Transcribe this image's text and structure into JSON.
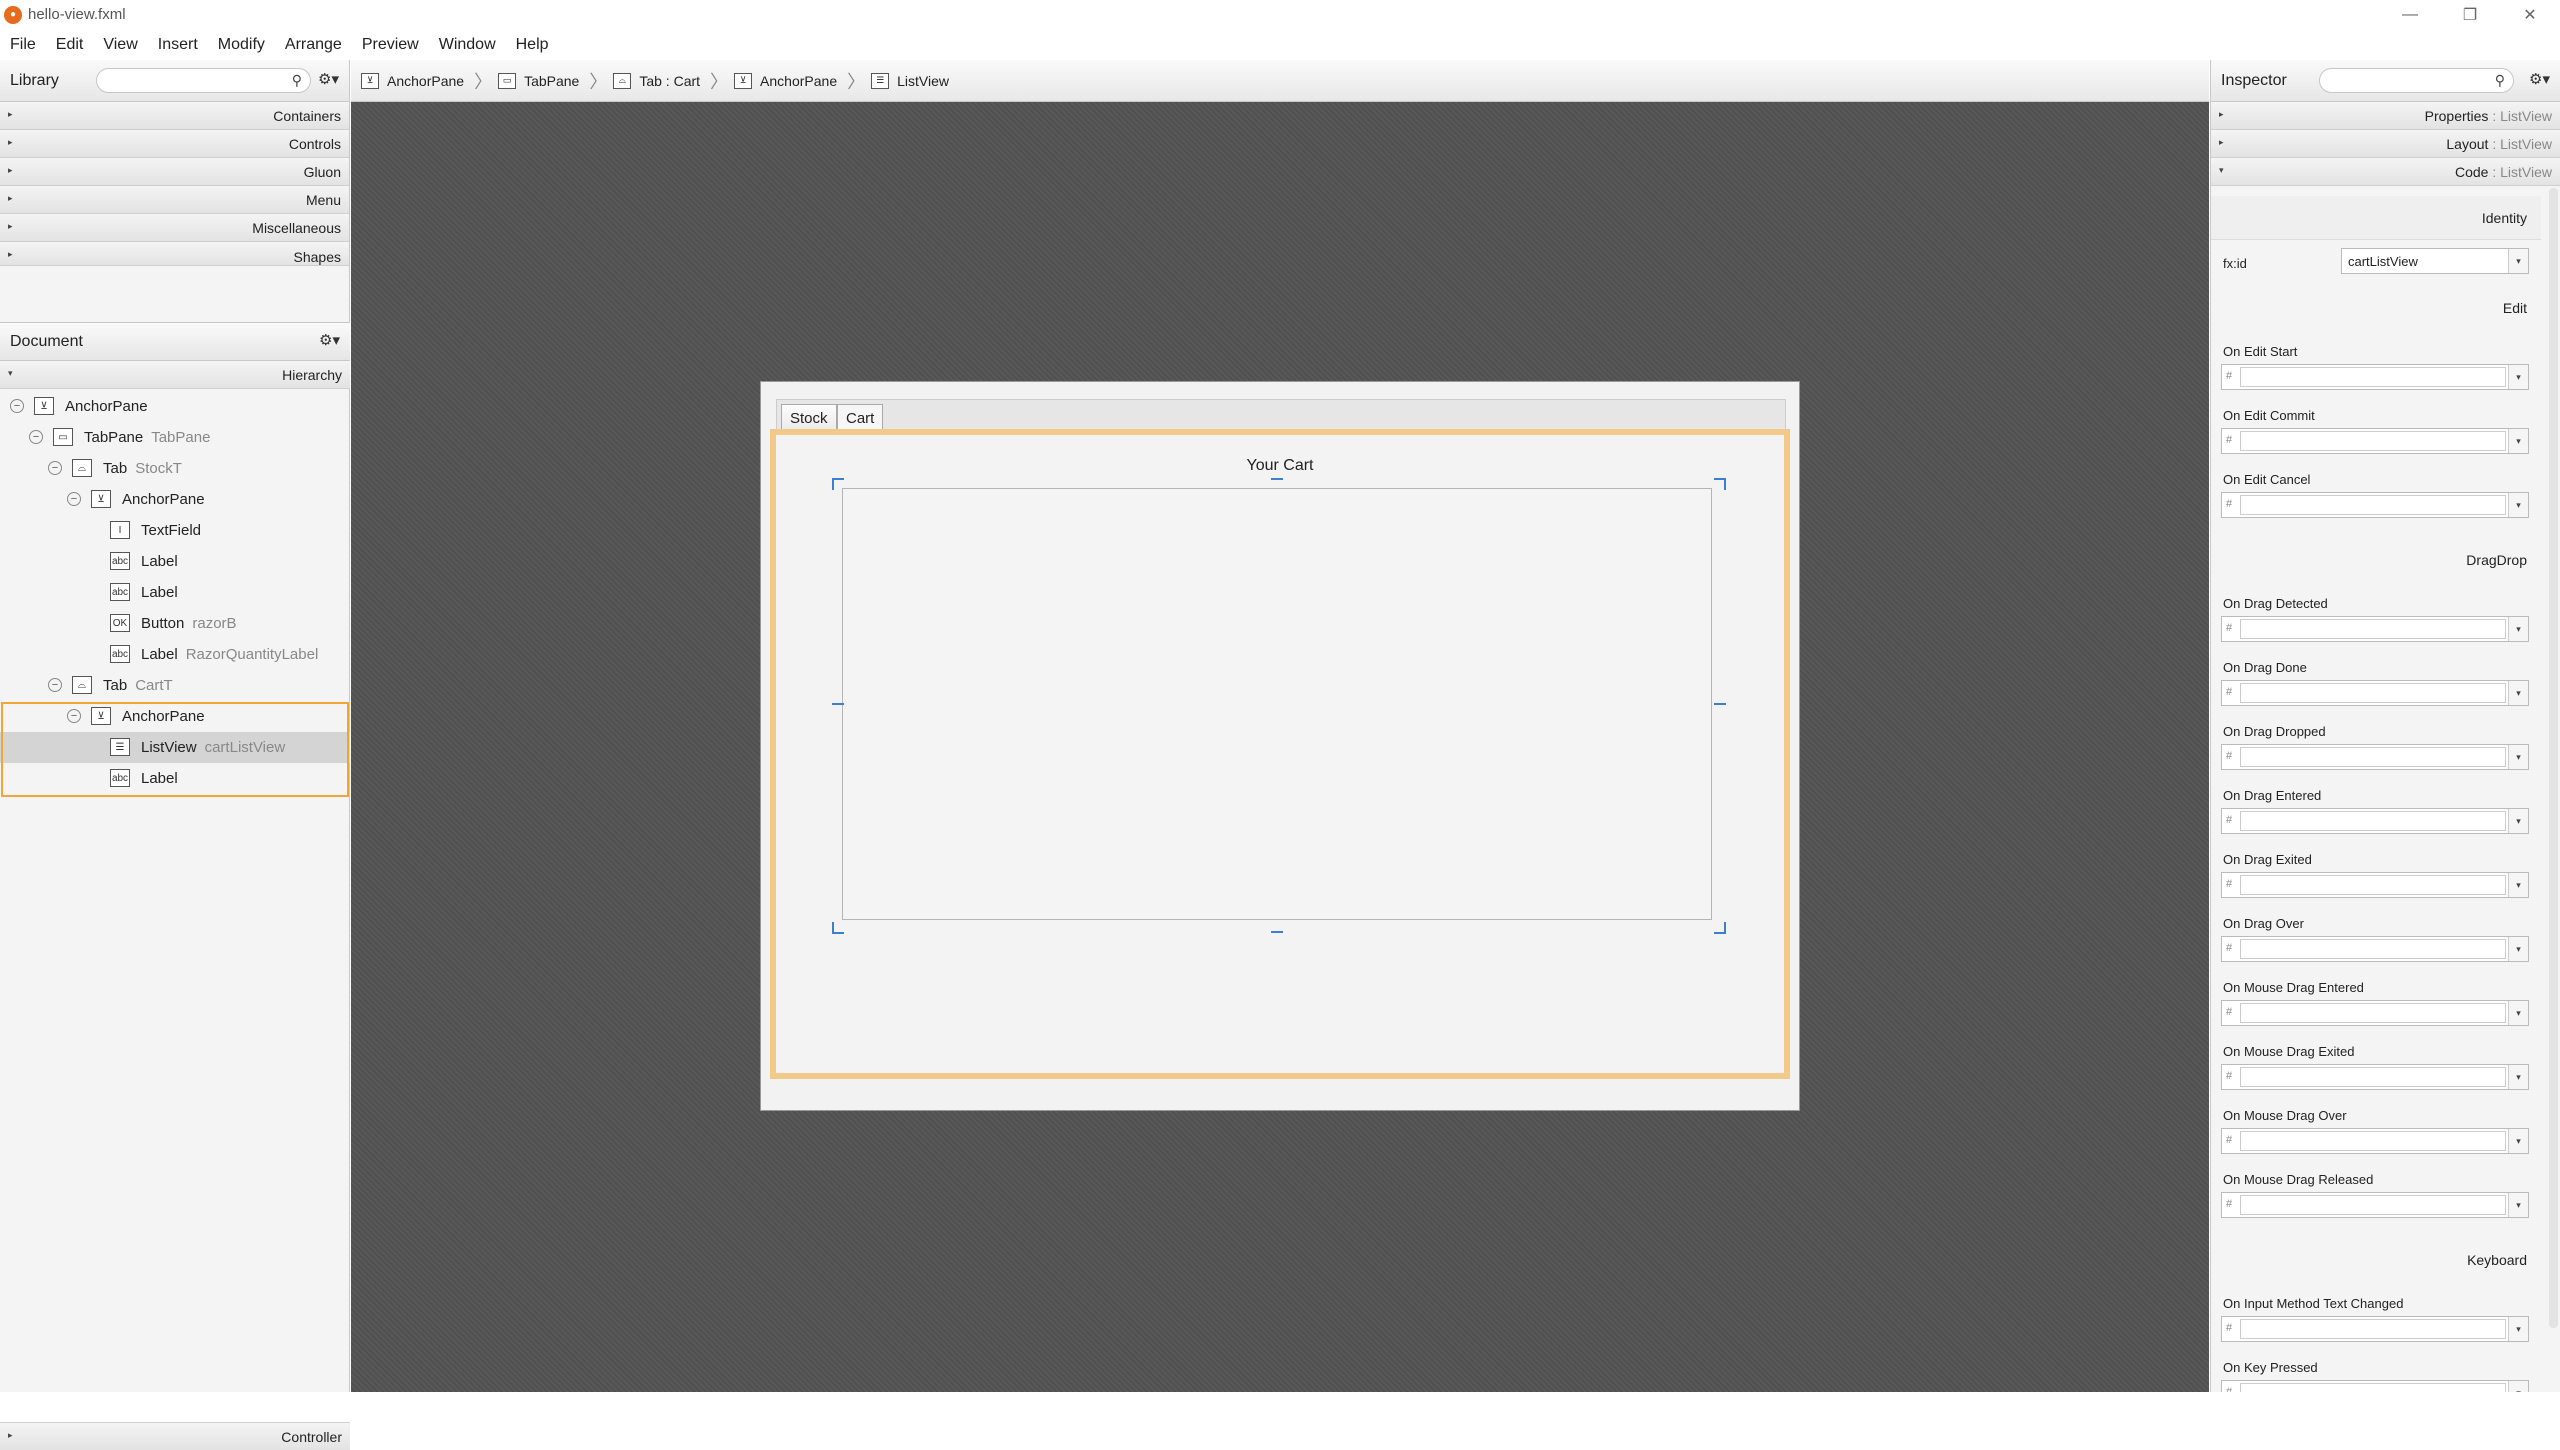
{
  "window": {
    "title": "hello-view.fxml",
    "controls": [
      "—",
      "❐",
      "✕"
    ]
  },
  "menu": [
    "File",
    "Edit",
    "View",
    "Insert",
    "Modify",
    "Arrange",
    "Preview",
    "Window",
    "Help"
  ],
  "library": {
    "title": "Library",
    "sections": [
      "Containers",
      "Controls",
      "Gluon",
      "Menu",
      "Miscellaneous",
      "Shapes"
    ]
  },
  "document": {
    "title": "Document",
    "hierarchy_label": "Hierarchy",
    "controller_label": "Controller",
    "tree": [
      {
        "name": "AnchorPane",
        "id": "",
        "icon": "anchor-pane-icon",
        "glyph": "⊻",
        "depth": 0,
        "toggle": "−"
      },
      {
        "name": "TabPane",
        "id": "TabPane",
        "icon": "tab-pane-icon",
        "glyph": "▭",
        "depth": 1,
        "toggle": "−"
      },
      {
        "name": "Tab",
        "id": "StockT",
        "icon": "tab-icon",
        "glyph": "⌓",
        "depth": 2,
        "toggle": "−"
      },
      {
        "name": "AnchorPane",
        "id": "",
        "icon": "anchor-pane-icon",
        "glyph": "⊻",
        "depth": 3,
        "toggle": "−"
      },
      {
        "name": "TextField",
        "id": "",
        "icon": "text-field-icon",
        "glyph": "I",
        "depth": 4,
        "toggle": ""
      },
      {
        "name": "Label",
        "id": "",
        "icon": "label-icon",
        "glyph": "abc",
        "depth": 4,
        "toggle": ""
      },
      {
        "name": "Label",
        "id": "",
        "icon": "label-icon",
        "glyph": "abc",
        "depth": 4,
        "toggle": ""
      },
      {
        "name": "Button",
        "id": "razorB",
        "icon": "button-icon",
        "glyph": "OK",
        "depth": 4,
        "toggle": ""
      },
      {
        "name": "Label",
        "id": "RazorQuantityLabel",
        "icon": "label-icon",
        "glyph": "abc",
        "depth": 4,
        "toggle": ""
      },
      {
        "name": "Tab",
        "id": "CartT",
        "icon": "tab-icon",
        "glyph": "⌓",
        "depth": 2,
        "toggle": "−"
      },
      {
        "name": "AnchorPane",
        "id": "",
        "icon": "anchor-pane-icon",
        "glyph": "⊻",
        "depth": 3,
        "toggle": "−"
      },
      {
        "name": "ListView",
        "id": "cartListView",
        "icon": "list-view-icon",
        "glyph": "☰",
        "depth": 4,
        "toggle": ""
      },
      {
        "name": "Label",
        "id": "",
        "icon": "label-icon",
        "glyph": "abc",
        "depth": 4,
        "toggle": ""
      }
    ]
  },
  "breadcrumb": [
    {
      "label": "AnchorPane",
      "icon": "anchor-pane-icon",
      "glyph": "⊻"
    },
    {
      "label": "TabPane",
      "icon": "tab-pane-icon",
      "glyph": "▭"
    },
    {
      "label": "Tab : Cart",
      "icon": "tab-icon",
      "glyph": "⌓"
    },
    {
      "label": "AnchorPane",
      "icon": "anchor-pane-icon",
      "glyph": "⊻"
    },
    {
      "label": "ListView",
      "icon": "list-view-icon",
      "glyph": "☰"
    }
  ],
  "stage": {
    "tabs": [
      "Stock",
      "Cart"
    ],
    "cart_label": "Your Cart"
  },
  "inspector": {
    "title": "Inspector",
    "sections": [
      {
        "name": "Properties",
        "target": "ListView",
        "arrow": "▸"
      },
      {
        "name": "Layout",
        "target": "ListView",
        "arrow": "▸"
      },
      {
        "name": "Code",
        "target": "ListView",
        "arrow": "▾"
      }
    ],
    "identity_label": "Identity",
    "fxid_label": "fx:id",
    "fxid_value": "cartListView",
    "groups": [
      {
        "title": "Edit",
        "fields": [
          "On Edit Start",
          "On Edit Commit",
          "On Edit Cancel"
        ]
      },
      {
        "title": "DragDrop",
        "fields": [
          "On Drag Detected",
          "On Drag Done",
          "On Drag Dropped",
          "On Drag Entered",
          "On Drag Exited",
          "On Drag Over",
          "On Mouse Drag Entered",
          "On Mouse Drag Exited",
          "On Mouse Drag Over",
          "On Mouse Drag Released"
        ]
      },
      {
        "title": "Keyboard",
        "fields": [
          "On Input Method Text Changed",
          "On Key Pressed"
        ]
      }
    ]
  },
  "colors": {
    "selection": "#f0a535",
    "handles": "#3b7fd0",
    "canvas": "#545454"
  }
}
